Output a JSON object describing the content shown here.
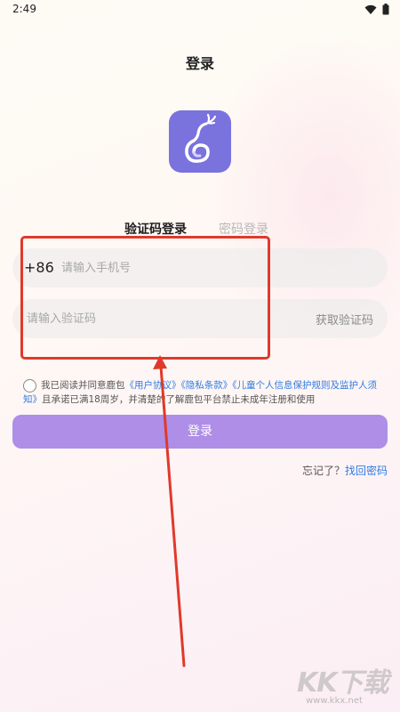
{
  "status_bar": {
    "time": "2:49",
    "icons": [
      "wifi-icon",
      "battery-icon"
    ]
  },
  "header": {
    "title": "登录"
  },
  "app": {
    "logo_icon": "deer-logo-icon",
    "brand_color": "#7a72dd"
  },
  "tabs": [
    {
      "label": "验证码登录",
      "active": true
    },
    {
      "label": "密码登录",
      "active": false
    }
  ],
  "form": {
    "country_code": "+86",
    "phone_placeholder": "请输入手机号",
    "phone_value": "",
    "code_placeholder": "请输入验证码",
    "code_value": "",
    "get_code_label": "获取验证码"
  },
  "agreement": {
    "checked": false,
    "text_prefix": "我已阅读并同意鹿包",
    "link_user_agreement": "《用户协议》",
    "link_privacy": "《隐私条款》",
    "link_children": "《儿童个人信息保护规则及监护人须知》",
    "text_suffix": "且承诺已满18周岁，并清楚的了解鹿包平台禁止未成年注册和使用"
  },
  "login_button": {
    "label": "登录",
    "color": "#ae8ee6"
  },
  "forgot": {
    "prompt": "忘记了？",
    "link": "找回密码"
  },
  "colors": {
    "link": "#2f7be3",
    "annotation": "#e0392b"
  },
  "watermark": {
    "logo_text": "KK下载",
    "url": "www.kkx.net"
  }
}
